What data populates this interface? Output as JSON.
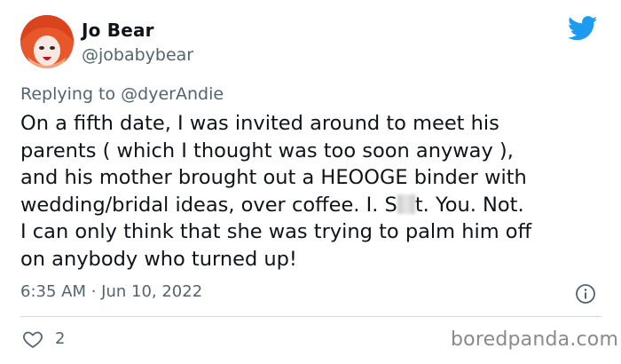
{
  "author": {
    "name": "Jo Bear",
    "handle": "@jobabybear"
  },
  "reply": {
    "prefix": "Replying to",
    "mention": "@dyerAndie"
  },
  "tweet": {
    "lines": [
      "On a fifth date, I was invited around to meet his",
      "parents ( which I thought was too soon anyway ),",
      "and his mother brought out a HEOOGE binder with",
      "wedding/bridal ideas, over coffee. I. S",
      "t. You. Not.",
      "I can only think that she was trying to palm him off",
      "on anybody who turned up!"
    ],
    "timestamp": "6:35 AM · Jun 10, 2022"
  },
  "actions": {
    "like_count": "2"
  },
  "watermark": "boredpanda.com",
  "colors": {
    "twitter_blue": "#1d9bf0",
    "secondary_text": "#536471",
    "primary_text": "#0f1419"
  },
  "icons": {
    "logo": "twitter-bird-icon",
    "info": "info-icon",
    "like": "heart-icon"
  }
}
